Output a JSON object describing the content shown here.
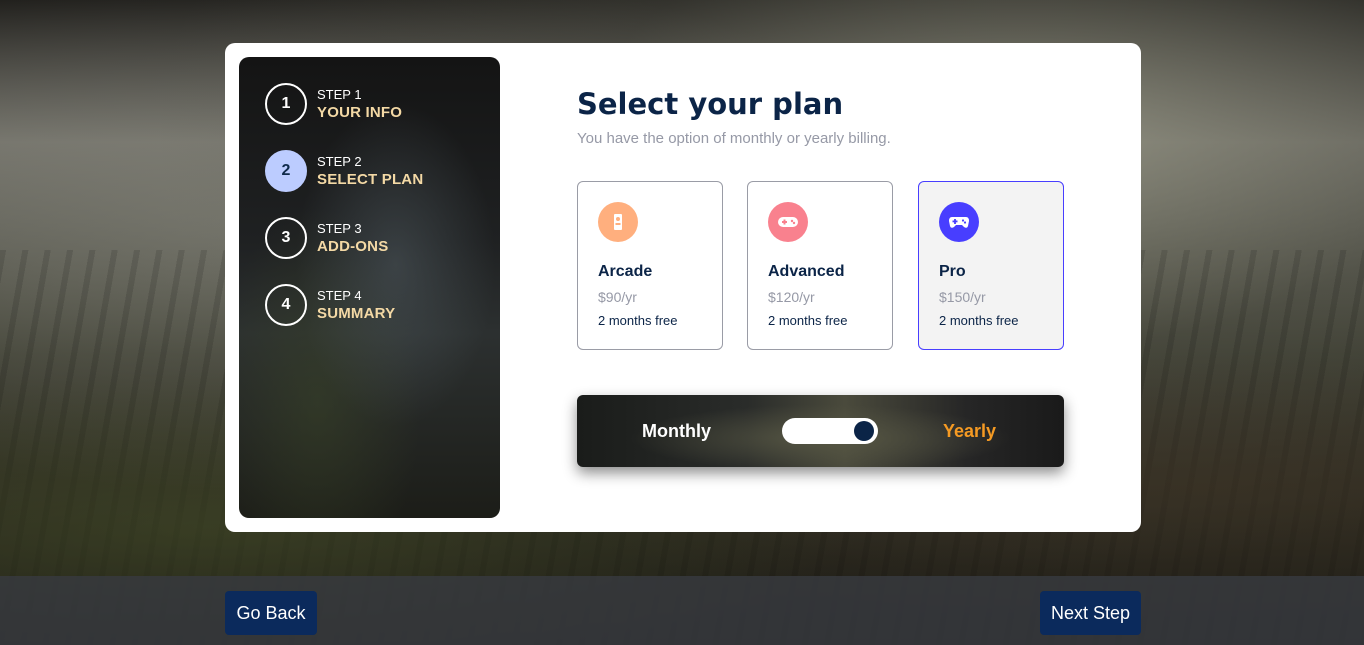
{
  "sidebar": {
    "steps": [
      {
        "number": "1",
        "label": "STEP 1",
        "title": "YOUR INFO",
        "active": false
      },
      {
        "number": "2",
        "label": "STEP 2",
        "title": "SELECT PLAN",
        "active": true
      },
      {
        "number": "3",
        "label": "STEP 3",
        "title": "ADD-ONS",
        "active": false
      },
      {
        "number": "4",
        "label": "STEP 4",
        "title": "SUMMARY",
        "active": false
      }
    ]
  },
  "main": {
    "title": "Select your plan",
    "subtitle": "You have the option of monthly or yearly billing."
  },
  "plans": [
    {
      "name": "Arcade",
      "price": "$90/yr",
      "bonus": "2 months free",
      "icon": "arcade-icon",
      "color": "#ffaf7e",
      "selected": false
    },
    {
      "name": "Advanced",
      "price": "$120/yr",
      "bonus": "2 months free",
      "icon": "gamepad-icon",
      "color": "#f9818e",
      "selected": false
    },
    {
      "name": "Pro",
      "price": "$150/yr",
      "bonus": "2 months free",
      "icon": "controller-icon",
      "color": "#483eff",
      "selected": true
    }
  ],
  "billing": {
    "monthly_label": "Monthly",
    "yearly_label": "Yearly",
    "selected": "yearly"
  },
  "footer": {
    "back_label": "Go Back",
    "next_label": "Next Step"
  },
  "colors": {
    "accent_orange": "#f59a23",
    "navy": "#0b2447",
    "button": "#0b2a5c"
  }
}
